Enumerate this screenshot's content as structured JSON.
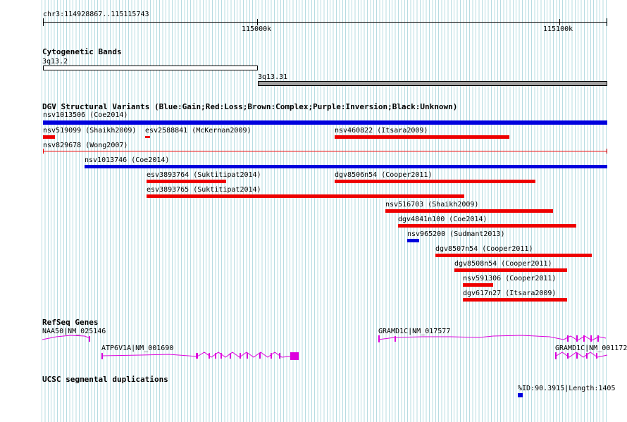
{
  "ruler": {
    "range_label": "chr3:114928867..115115743",
    "tick_labels": [
      "115000k",
      "115100k"
    ]
  },
  "tracks": {
    "cytoband": {
      "title": "Cytogenetic Bands",
      "bands": [
        {
          "label": "3q13.2",
          "color": "#ffffff"
        },
        {
          "label": "3q13.31",
          "color": "#a0a0a0"
        }
      ]
    },
    "dgv": {
      "title": "DGV Structural Variants (Blue:Gain;Red:Loss;Brown:Complex;Purple:Inversion;Black:Unknown)",
      "colors": {
        "gain": "#0000dd",
        "loss": "#ee0000"
      },
      "features": [
        {
          "label": "nsv1013506 (Coe2014)",
          "type": "gain"
        },
        {
          "label": "nsv519099 (Shaikh2009)",
          "type": "loss"
        },
        {
          "label": "esv2588841 (McKernan2009)",
          "type": "loss"
        },
        {
          "label": "nsv460822 (Itsara2009)",
          "type": "loss"
        },
        {
          "label": "nsv829678 (Wong2007)",
          "type": "loss"
        },
        {
          "label": "nsv1013746 (Coe2014)",
          "type": "gain"
        },
        {
          "label": "esv3893764 (Suktitipat2014)",
          "type": "loss"
        },
        {
          "label": "dgv8506n54 (Cooper2011)",
          "type": "loss"
        },
        {
          "label": "esv3893765 (Suktitipat2014)",
          "type": "loss"
        },
        {
          "label": "nsv516703 (Shaikh2009)",
          "type": "loss"
        },
        {
          "label": "dgv4841n100 (Coe2014)",
          "type": "loss"
        },
        {
          "label": "nsv965200 (Sudmant2013)",
          "type": "gain"
        },
        {
          "label": "dgv8507n54 (Cooper2011)",
          "type": "loss"
        },
        {
          "label": "dgv8508n54 (Cooper2011)",
          "type": "loss"
        },
        {
          "label": "nsv591306 (Cooper2011)",
          "type": "loss"
        },
        {
          "label": "dgv617n27 (Itsara2009)",
          "type": "loss"
        }
      ]
    },
    "refseq": {
      "title": "RefSeq Genes",
      "color": "#dd00dd",
      "genes": [
        {
          "label": "NAA50|NM_025146"
        },
        {
          "label": "ATP6V1A|NM_001690"
        },
        {
          "label": "GRAMD1C|NM_017577"
        },
        {
          "label": "GRAMD1C|NM_001172"
        }
      ]
    },
    "segdup": {
      "title": "UCSC segmental duplications",
      "label": "%ID:90.3915|Length:1405",
      "color": "#0000dd"
    }
  }
}
